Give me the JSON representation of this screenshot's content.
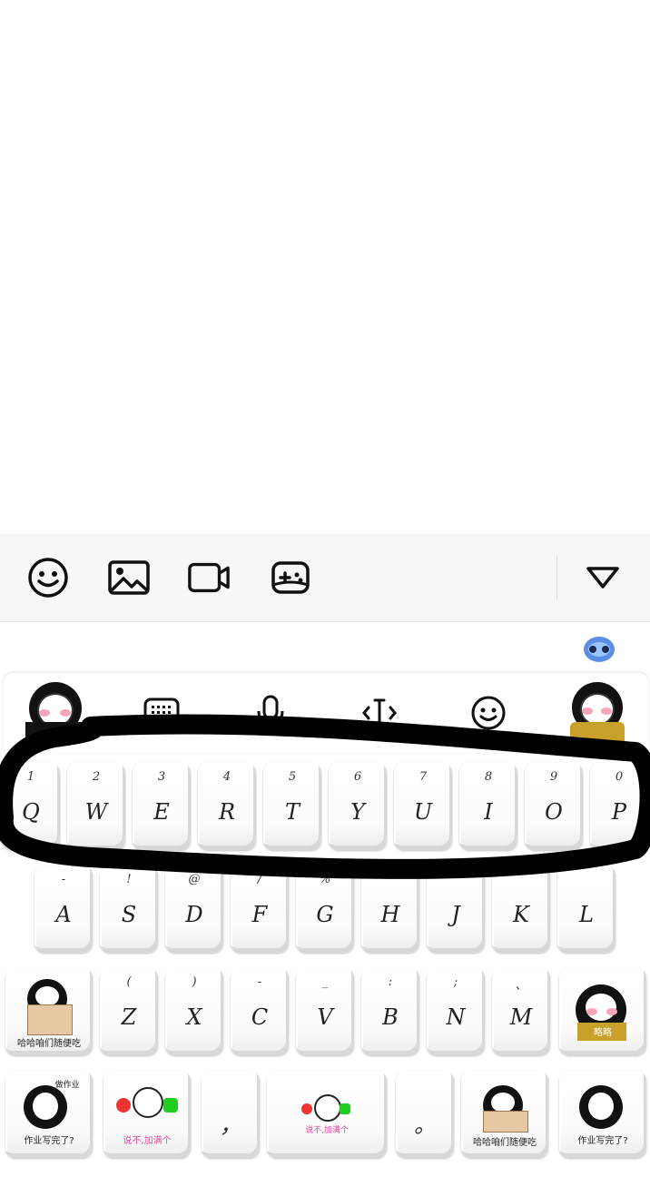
{
  "composer_toolbar": {
    "icons": [
      "smiley-icon",
      "image-icon",
      "video-camera-icon",
      "gamepad-icon"
    ],
    "collapse_icon": "triangle-down-icon"
  },
  "keyboard": {
    "assistant_icon": "ai-assistant-icon",
    "tools": [
      "keyboard-icon",
      "microphone-icon",
      "cursor-icon",
      "emoji-icon"
    ],
    "row1": [
      {
        "main": "Q",
        "sub": "1"
      },
      {
        "main": "W",
        "sub": "2"
      },
      {
        "main": "E",
        "sub": "3"
      },
      {
        "main": "R",
        "sub": "4"
      },
      {
        "main": "T",
        "sub": "5"
      },
      {
        "main": "Y",
        "sub": "6"
      },
      {
        "main": "U",
        "sub": "7"
      },
      {
        "main": "I",
        "sub": "8"
      },
      {
        "main": "O",
        "sub": "9"
      },
      {
        "main": "P",
        "sub": "0"
      }
    ],
    "row2": [
      {
        "main": "A",
        "sub": "-"
      },
      {
        "main": "S",
        "sub": "!"
      },
      {
        "main": "D",
        "sub": "@"
      },
      {
        "main": "F",
        "sub": "/"
      },
      {
        "main": "G",
        "sub": "%"
      },
      {
        "main": "H",
        "sub": ""
      },
      {
        "main": "J",
        "sub": ""
      },
      {
        "main": "K",
        "sub": ""
      },
      {
        "main": "L",
        "sub": ""
      }
    ],
    "row3": [
      {
        "main": "Z",
        "sub": "("
      },
      {
        "main": "X",
        "sub": ")"
      },
      {
        "main": "C",
        "sub": "-"
      },
      {
        "main": "V",
        "sub": "_"
      },
      {
        "main": "B",
        "sub": ":"
      },
      {
        "main": "N",
        "sub": ";"
      },
      {
        "main": "M",
        "sub": "、"
      }
    ],
    "comma": "，",
    "period": "。",
    "sticker_captions": {
      "shift_sticker": "哈哈咱们随便吃",
      "enter_sticker": "略略",
      "bottom_left_top": "做作业",
      "bottom_left": "作业写完了?",
      "bottom_left2": "说不,加满个",
      "space_caption": "说不,加满个",
      "bottom_right1": "哈哈咱们随便吃",
      "bottom_right2": "作业写完了?"
    }
  }
}
